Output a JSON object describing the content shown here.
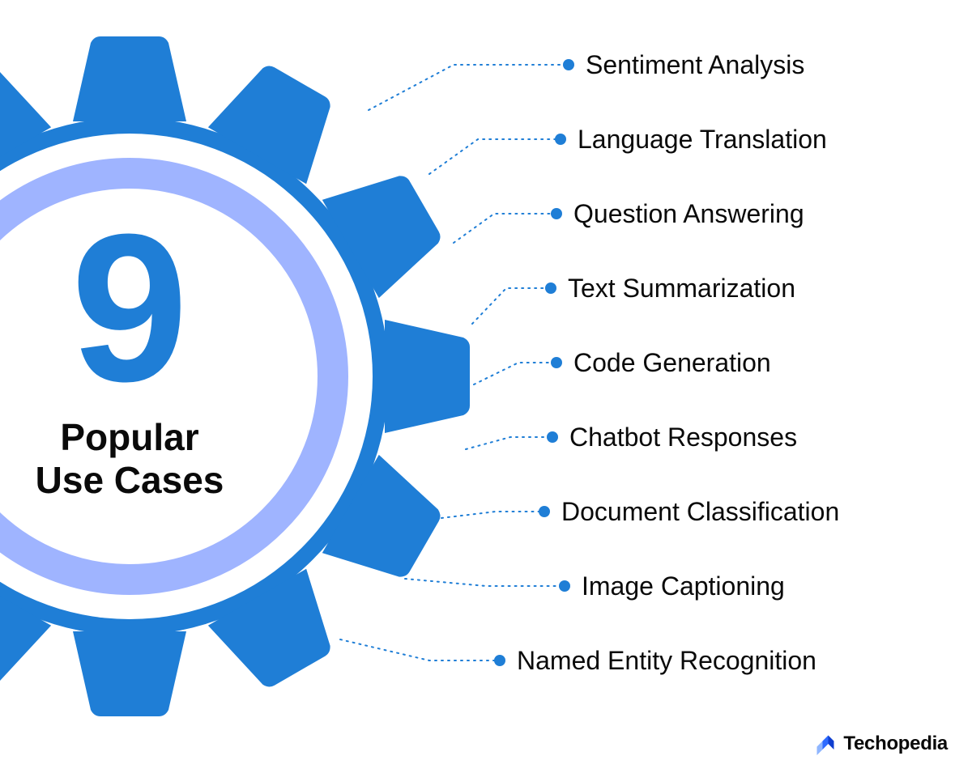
{
  "hub": {
    "number": "9",
    "line1": "Popular",
    "line2": "Use Cases"
  },
  "colors": {
    "gear": "#1f7ed6",
    "ring": "#9fb4ff",
    "dot": "#1f7ed6",
    "connector": "#1f7ed6"
  },
  "items": [
    {
      "label": "Sentiment Analysis"
    },
    {
      "label": "Language Translation"
    },
    {
      "label": "Question Answering"
    },
    {
      "label": "Text Summarization"
    },
    {
      "label": "Code Generation"
    },
    {
      "label": "Chatbot Responses"
    },
    {
      "label": "Document Classification"
    },
    {
      "label": "Image Captioning"
    },
    {
      "label": "Named Entity Recognition"
    }
  ],
  "brand": {
    "name": "Techopedia"
  }
}
